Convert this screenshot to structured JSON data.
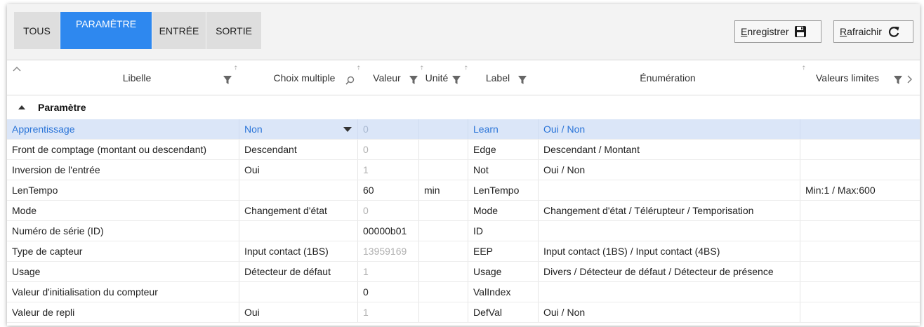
{
  "tabs": [
    {
      "label": "TOUS"
    },
    {
      "label": "PARAMÈTRE"
    },
    {
      "label": "ENTRÉE"
    },
    {
      "label": "SORTIE"
    }
  ],
  "toolbar": {
    "save_label": "Enregistrer",
    "refresh_label": "Rafraichir"
  },
  "columns": {
    "libelle": "Libelle",
    "choix": "Choix multiple",
    "valeur": "Valeur",
    "unite": "Unité",
    "label": "Label",
    "enumeration": "Énumération",
    "limites": "Valeurs limites"
  },
  "group": {
    "title": "Paramètre"
  },
  "rows": [
    {
      "libelle": "Apprentissage",
      "choix": "Non",
      "valeur": "0",
      "unite": "",
      "label": "Learn",
      "enumeration": "Oui / Non",
      "limites": ""
    },
    {
      "libelle": "Front de comptage (montant ou descendant)",
      "choix": "Descendant",
      "valeur": "0",
      "unite": "",
      "label": "Edge",
      "enumeration": "Descendant / Montant",
      "limites": ""
    },
    {
      "libelle": "Inversion de l'entrée",
      "choix": "Oui",
      "valeur": "1",
      "unite": "",
      "label": "Not",
      "enumeration": "Oui / Non",
      "limites": ""
    },
    {
      "libelle": "LenTempo",
      "choix": "",
      "valeur": "60",
      "unite": "min",
      "label": "LenTempo",
      "enumeration": "",
      "limites": "Min:1 / Max:600"
    },
    {
      "libelle": "Mode",
      "choix": "Changement d'état",
      "valeur": "0",
      "unite": "",
      "label": "Mode",
      "enumeration": "Changement d'état / Télérupteur / Temporisation",
      "limites": ""
    },
    {
      "libelle": "Numéro de série (ID)",
      "choix": "",
      "valeur": "00000b01",
      "unite": "",
      "label": "ID",
      "enumeration": "",
      "limites": ""
    },
    {
      "libelle": "Type de capteur",
      "choix": "Input contact (1BS)",
      "valeur": "13959169",
      "unite": "",
      "label": "EEP",
      "enumeration": "Input contact (1BS) / Input contact (4BS)",
      "limites": ""
    },
    {
      "libelle": "Usage",
      "choix": "Détecteur de défaut",
      "valeur": "1",
      "unite": "",
      "label": "Usage",
      "enumeration": "Divers / Détecteur de défaut / Détecteur de présence",
      "limites": ""
    },
    {
      "libelle": "Valeur d'initialisation du compteur",
      "choix": "",
      "valeur": "0",
      "unite": "",
      "label": "ValIndex",
      "enumeration": "",
      "limites": ""
    },
    {
      "libelle": "Valeur de repli",
      "choix": "Oui",
      "valeur": "1",
      "unite": "",
      "label": "DefVal",
      "enumeration": "Oui / Non",
      "limites": ""
    }
  ],
  "colors": {
    "accent": "#2e88ef",
    "selected_row": "#dbe6f8",
    "selected_text": "#2a74d8"
  },
  "icons": [
    "floppy-disk-icon",
    "refresh-icon",
    "filter-icon",
    "search-icon",
    "sort-arrows-icon",
    "chevron-right-icon",
    "collapse-caret-icon",
    "dropdown-caret-icon"
  ]
}
